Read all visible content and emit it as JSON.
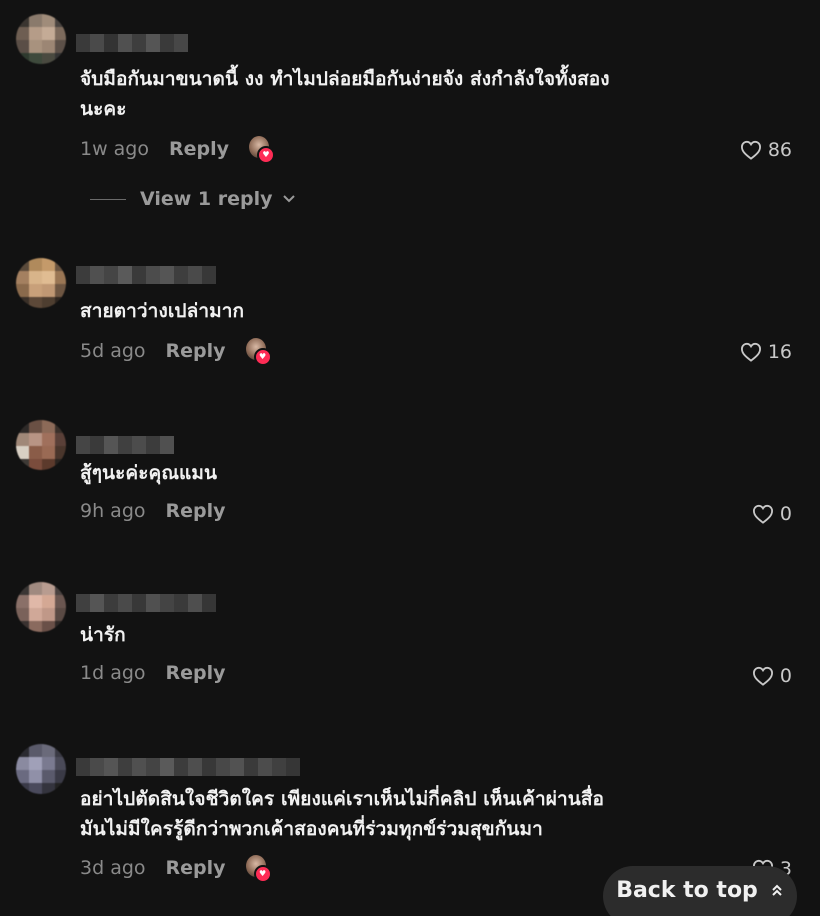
{
  "comments": [
    {
      "text_lines": [
        "จับมือกันมาขนาดนี้ งง ทำไมปล่อยมือกันง่ายจัง ส่งกำลังใจทั้งสอง",
        "นะคะ"
      ],
      "time": "1w ago",
      "reply_label": "Reply",
      "likes": "86",
      "creator_liked": true
    },
    {
      "text_lines": [
        "สายตาว่างเปล่ามาก"
      ],
      "time": "5d ago",
      "reply_label": "Reply",
      "likes": "16",
      "creator_liked": true
    },
    {
      "text_lines": [
        "สู้ๆนะค่ะคุณแมน"
      ],
      "time": "9h ago",
      "reply_label": "Reply",
      "likes": "0",
      "creator_liked": false
    },
    {
      "text_lines": [
        "น่ารัก"
      ],
      "time": "1d ago",
      "reply_label": "Reply",
      "likes": "0",
      "creator_liked": false
    },
    {
      "text_lines": [
        "อย่าไปตัดสินใจชีวิตใคร เพียงแค่เราเห็นไม่กี่คลิป เห็นเค้าผ่านสื่อ",
        "มันไม่มีใครรู้ดีกว่าพวกเค้าสองคนที่ร่วมทุกข์ร่วมสุขกันมา"
      ],
      "time": "3d ago",
      "reply_label": "Reply",
      "likes": "3",
      "creator_liked": true
    }
  ],
  "view_replies_label": "View 1 reply",
  "back_to_top_label": "Back to top",
  "icons": {
    "like": "heart-outline-icon",
    "chevron": "chevron-down-icon",
    "back_to_top": "double-chevron-up-icon",
    "creator_heart": "heart-filled-icon"
  },
  "colors": {
    "background": "#121212",
    "text": "#f1f1f1",
    "muted": "#8a8a8a",
    "accent": "#fe2c55"
  }
}
